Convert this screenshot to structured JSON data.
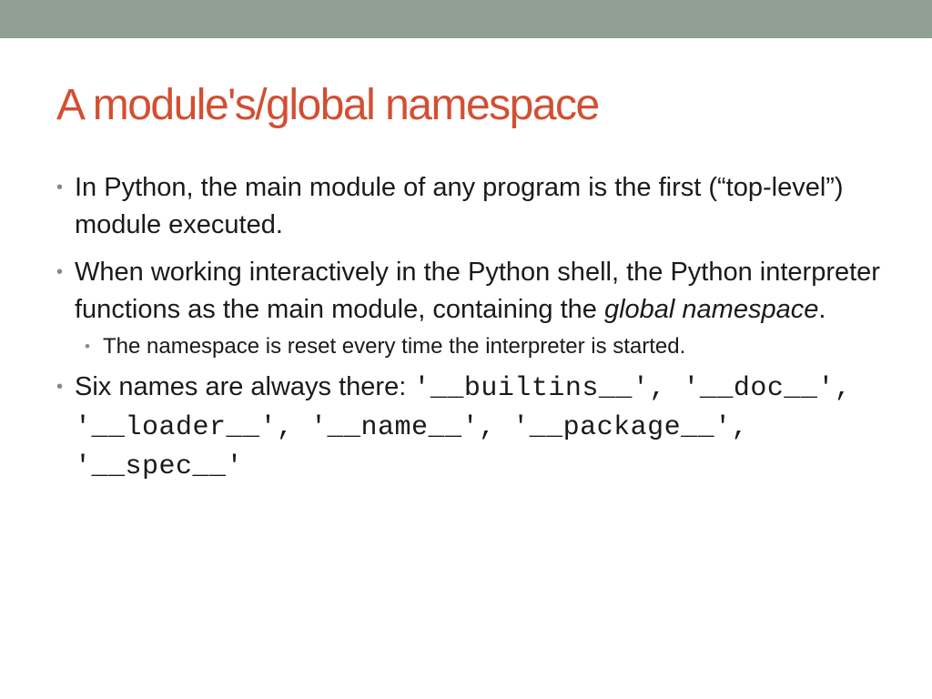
{
  "theme": {
    "band_color": "#90a093",
    "title_color": "#d34f32",
    "bullet_color": "#7f8c83",
    "text_color": "#1a1a1a"
  },
  "title": "A module's/global namespace",
  "bullets": [
    {
      "text_1": "In Python, the main module of any program is the first (“top-level”) module executed",
      "text_2": "."
    },
    {
      "text_1": "When working interactively in the Python shell, the Python interpreter functions as the main module, containing the ",
      "italic": "global namespace",
      "text_2": "."
    },
    {
      "sub": "The namespace is reset every time the interpreter is started."
    },
    {
      "text_1": "Six names are always there: ",
      "code": "'__builtins__', '__doc__', '__loader__', '__name__', '__package__', '__spec__'"
    }
  ],
  "bullet_icon": "bullet-dot-icon"
}
